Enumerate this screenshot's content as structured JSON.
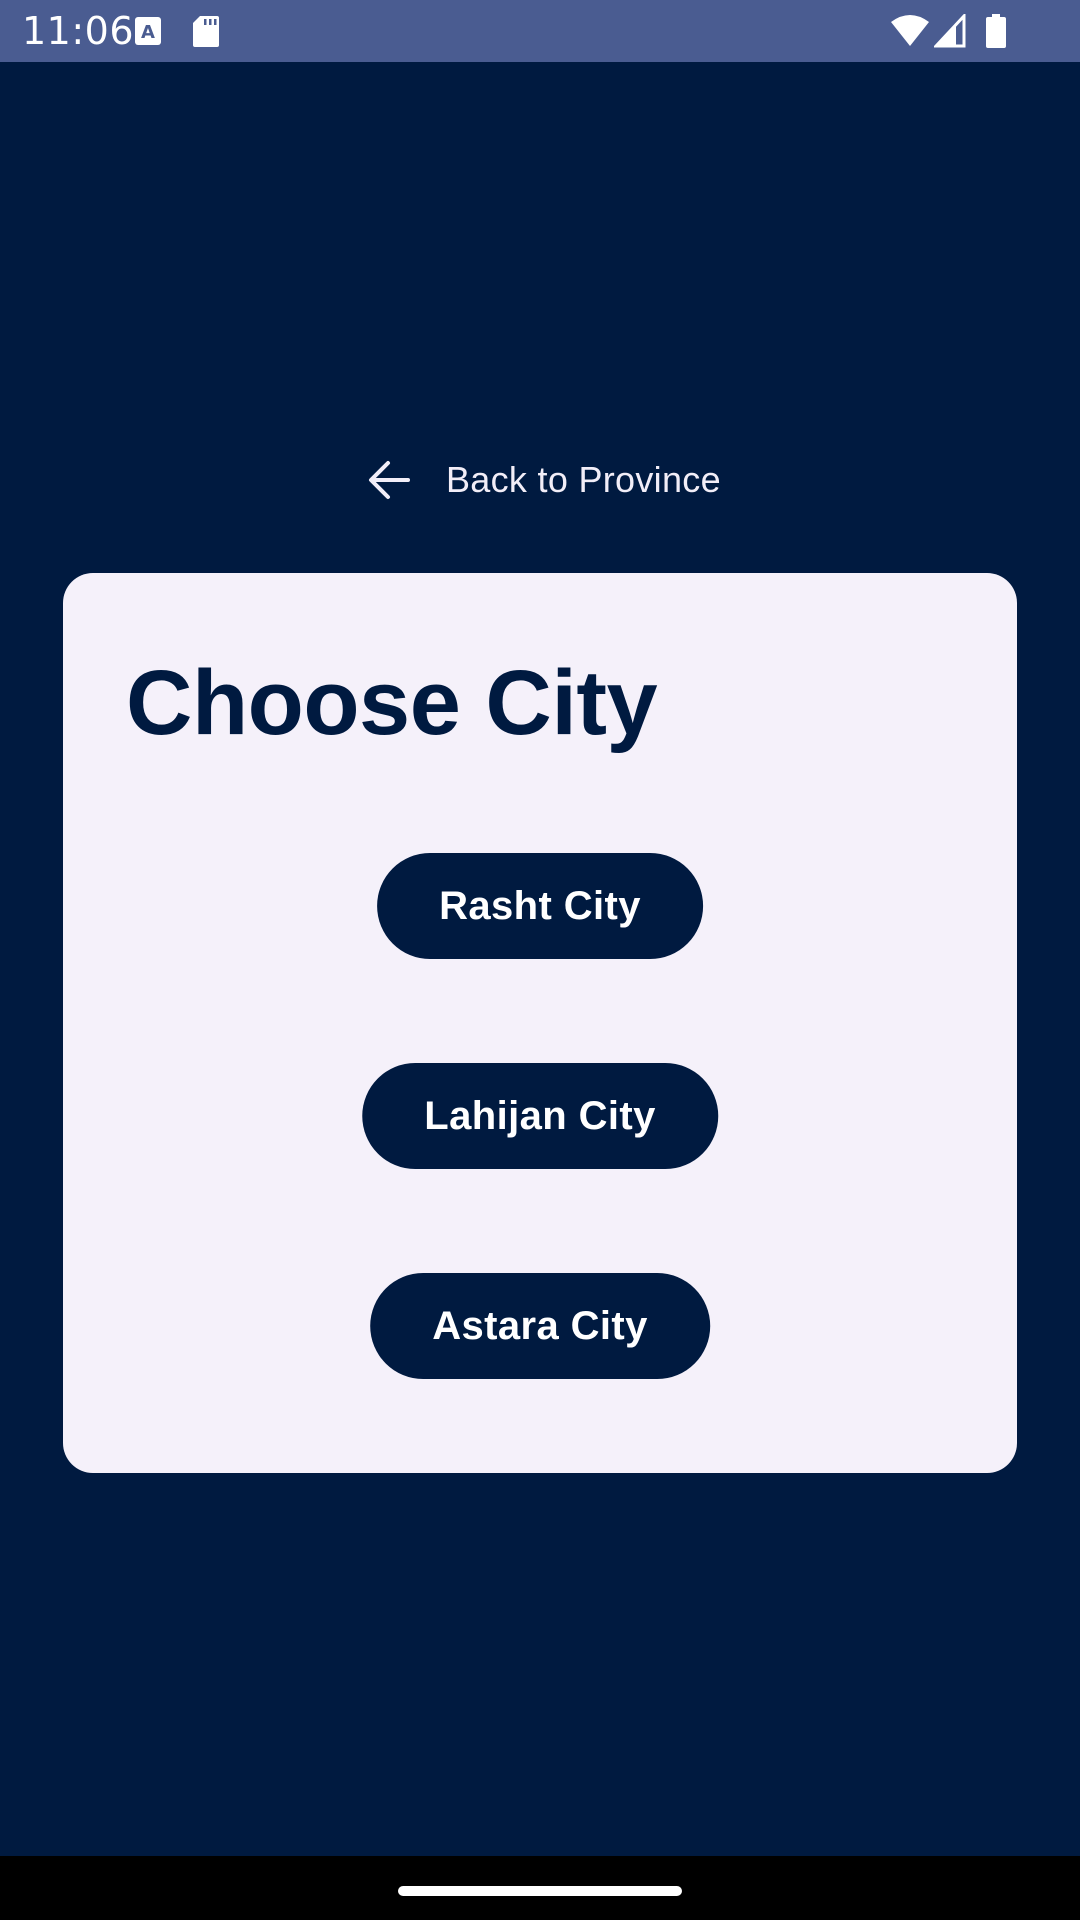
{
  "status_bar": {
    "time": "11:06",
    "icons": [
      "a-notification-icon",
      "sd-card-icon",
      "wifi-icon",
      "cell-signal-icon",
      "battery-icon"
    ]
  },
  "navigation": {
    "back_label": "Back to Province",
    "back_icon": "arrow-left-icon"
  },
  "card": {
    "title": "Choose City",
    "cities": [
      {
        "label": "Rasht City"
      },
      {
        "label": "Lahijan City"
      },
      {
        "label": "Astara City"
      }
    ]
  },
  "colors": {
    "background": "#001a40",
    "status_bar": "#4a5c91",
    "card": "#f5f1fa",
    "button": "#001a40",
    "button_text": "#ffffff"
  }
}
